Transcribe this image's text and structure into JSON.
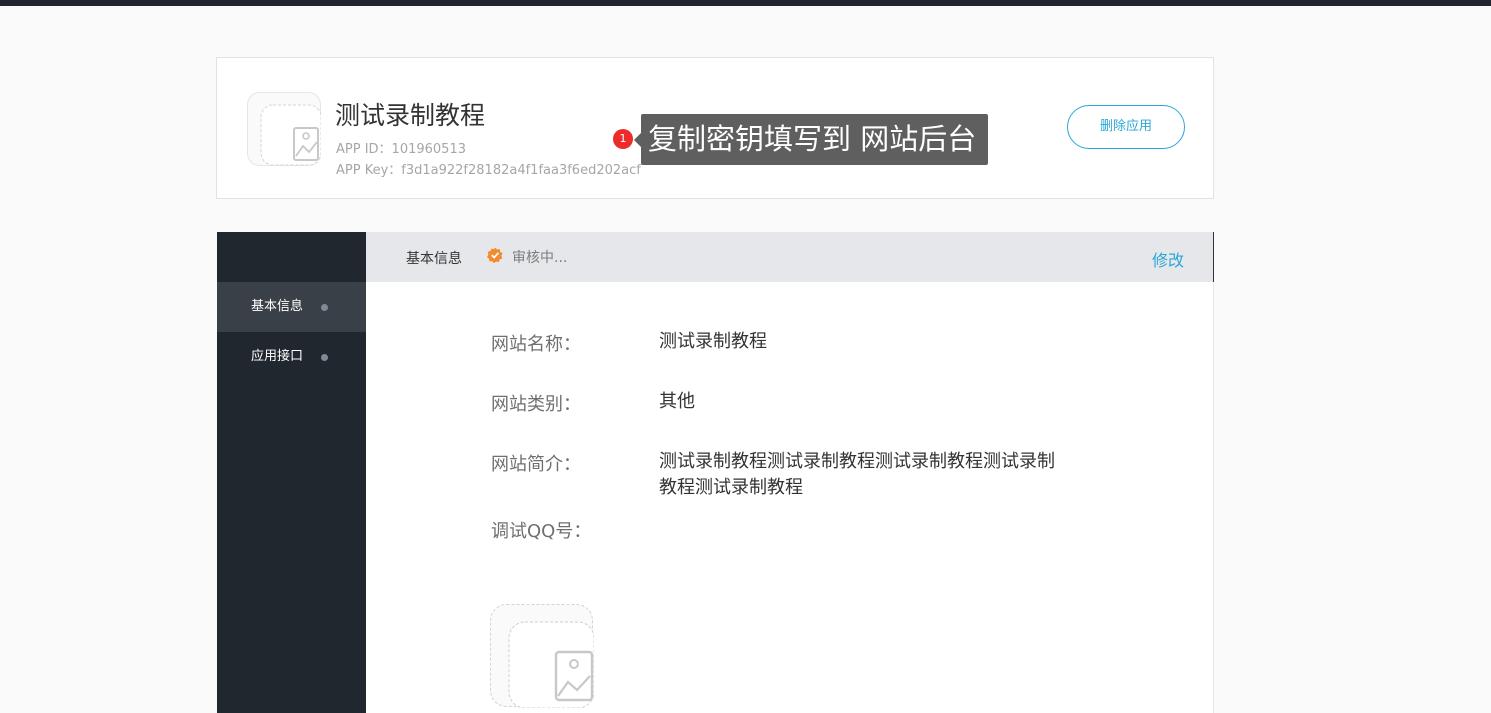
{
  "app": {
    "name": "测试录制教程",
    "id_line": "APP ID：101960513",
    "key_line": "APP Key：f3d1a922f28182a4f1faa3f6ed202acf",
    "delete_label": "删除应用"
  },
  "annotation": {
    "badge": "1",
    "text": "复制密钥填写到 网站后台"
  },
  "sidebar": {
    "items": [
      {
        "label": "基本信息",
        "active": true
      },
      {
        "label": "应用接口",
        "active": false
      }
    ]
  },
  "panel": {
    "title": "基本信息",
    "status": "审核中...",
    "status_color": "#f08c2e",
    "edit_label": "修改"
  },
  "fields": {
    "site_name_label": "网站名称：",
    "site_name_value": "测试录制教程",
    "site_type_label": "网站类别：",
    "site_type_value": "其他",
    "site_desc_label": "网站简介：",
    "site_desc_value": "测试录制教程测试录制教程测试录制教程测试录制教程测试录制教程",
    "qq_label": "调试QQ号："
  },
  "icons": {
    "app_icon": "image-placeholder-icon",
    "status_icon": "verified-badge-icon",
    "upload_icon": "image-placeholder-icon"
  },
  "colors": {
    "accent": "#2ba6d8",
    "sidebar_bg": "#20272e",
    "badge": "#ee2b2b"
  }
}
